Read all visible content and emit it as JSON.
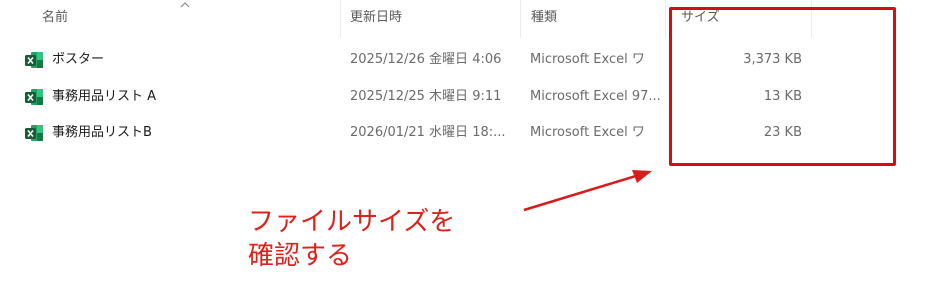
{
  "columns": {
    "name": "名前",
    "modified": "更新日時",
    "type": "種類",
    "size": "サイズ"
  },
  "files": [
    {
      "name": "ポスター",
      "modified": "2025/12/26 金曜日 4:06",
      "type": "Microsoft Excel ワ",
      "size": "3,373 KB",
      "icon": "excel-file-icon"
    },
    {
      "name": "事務用品リスト A",
      "modified": "2025/12/25 木曜日 9:11",
      "type": "Microsoft Excel 97...",
      "size": "13 KB",
      "icon": "excel-file-icon"
    },
    {
      "name": "事務用品リストB",
      "modified": "2026/01/21 水曜日 18:...",
      "type": "Microsoft Excel ワ",
      "size": "23 KB",
      "icon": "excel-file-icon"
    }
  ],
  "annotation": {
    "line1": "ファイルサイズを",
    "line2": "確認する",
    "color": "#e0201a"
  },
  "colors": {
    "highlight": "#d20f0f",
    "excel_green": "#1d7a3e"
  }
}
